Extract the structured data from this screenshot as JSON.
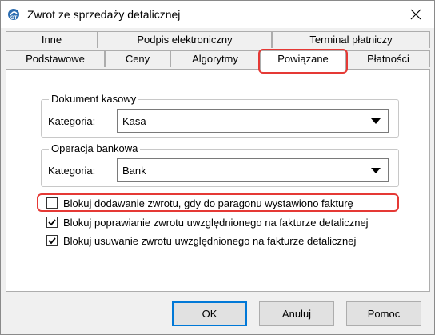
{
  "window": {
    "title": "Zwrot ze sprzedaży detalicznej",
    "icon": "app-gt-icon",
    "close_icon": "close-icon"
  },
  "tabs": {
    "row_top": [
      {
        "label": "Inne"
      },
      {
        "label": "Podpis elektroniczny"
      },
      {
        "label": "Terminal płatniczy"
      }
    ],
    "row_bottom": [
      {
        "label": "Podstawowe"
      },
      {
        "label": "Ceny"
      },
      {
        "label": "Algorytmy"
      },
      {
        "label": "Powiązane",
        "active": true
      },
      {
        "label": "Płatności"
      }
    ]
  },
  "groups": {
    "cash_document": {
      "legend": "Dokument kasowy",
      "field_label": "Kategoria:",
      "value": "Kasa"
    },
    "bank_operation": {
      "legend": "Operacja bankowa",
      "field_label": "Kategoria:",
      "value": "Bank"
    }
  },
  "checkboxes": [
    {
      "label": "Blokuj dodawanie zwrotu, gdy do paragonu wystawiono fakturę",
      "checked": false
    },
    {
      "label": "Blokuj poprawianie zwrotu uwzględnionego na fakturze detalicznej",
      "checked": true
    },
    {
      "label": "Blokuj usuwanie zwrotu uwzględnionego na fakturze detalicznej",
      "checked": true
    }
  ],
  "buttons": {
    "ok": "OK",
    "cancel": "Anuluj",
    "help": "Pomoc"
  },
  "colors": {
    "highlight": "#e53935",
    "accent": "#0078d7",
    "check": "#000000"
  }
}
